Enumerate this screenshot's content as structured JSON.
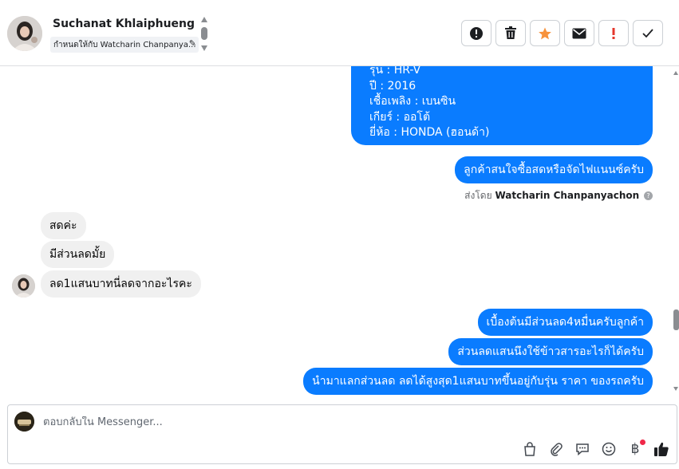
{
  "header": {
    "contact_name": "Suchanat Khlaiphueng",
    "assign_label": "กำหนดให้กับ Watcharin Chanpanya..."
  },
  "toolbar": {
    "buttons": [
      {
        "icon": "alert-circle-icon"
      },
      {
        "icon": "trash-icon"
      },
      {
        "icon": "star-icon",
        "color": "#f7923b"
      },
      {
        "icon": "envelope-icon"
      },
      {
        "icon": "exclamation-icon",
        "color": "#e4372c"
      },
      {
        "icon": "checkmark-icon"
      }
    ]
  },
  "messages": {
    "vehicle_details": [
      "รุ่น : HR-V",
      "ปี : 2016",
      "เชื้อเพลิง : เบนซิน",
      "เกียร์ : ออโต้",
      "ยี่ห้อ : HONDA (ฮอนด้า)"
    ],
    "outgoing_1": "ลูกค้าสนใจซื้อสดหรือจัดไฟแนนซ์ครับ",
    "sent_by_prefix": "ส่งโดย",
    "sent_by_name": "Watcharin Chanpanyachon",
    "incoming": [
      "สดค่ะ",
      "มีส่วนลดมั้ย",
      "ลด1แสนบาทนี่ลดจากอะไรคะ"
    ],
    "outgoing_2": [
      "เบื้องต้นมีส่วนลด4หมื่นครับลูกค้า",
      "ส่วนลดแสนนึงใช้ข้าวสารอะไรก็ได้ครับ",
      "นำมาแลกส่วนลด ลดได้สูงสุด1แสนบาทขึ้นอยู่กับรุ่น ราคา ของรถครับ"
    ]
  },
  "composer": {
    "placeholder": "ตอบกลับใน Messenger...",
    "baht_symbol": "฿",
    "tools": [
      "bag-icon",
      "paperclip-icon",
      "saved-replies-icon",
      "emoji-icon",
      "baht-icon",
      "thumbs-up-icon"
    ],
    "accent": "#1877f2"
  },
  "colors": {
    "outgoing_bubble": "#0a7cff",
    "incoming_bubble": "#f0f0f0"
  }
}
